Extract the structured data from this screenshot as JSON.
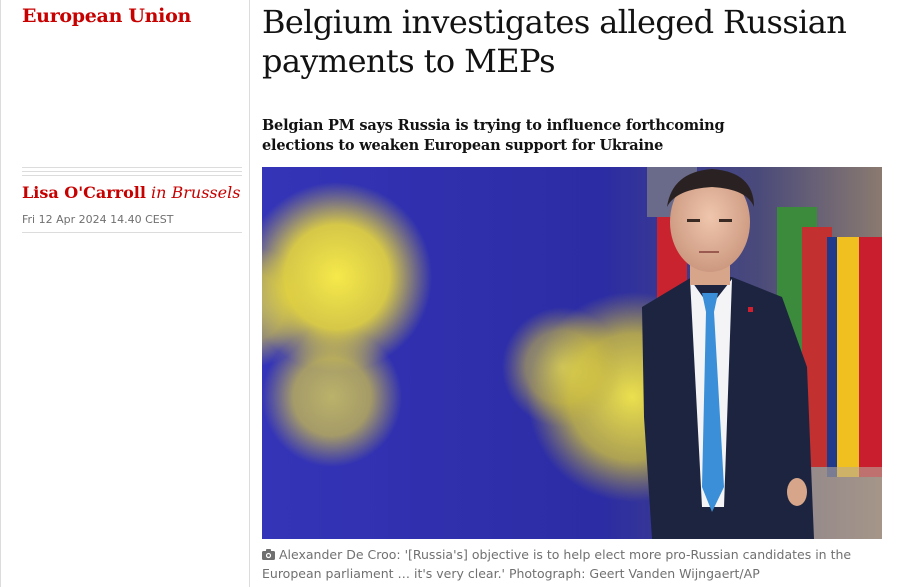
{
  "section": {
    "label": "European Union"
  },
  "byline": {
    "author": "Lisa O'Carroll",
    "location": "in Brussels"
  },
  "dateline": "Fri 12 Apr 2024 14.40 CEST",
  "article": {
    "headline": "Belgium investigates alleged Russian payments to MEPs",
    "standfirst": "Belgian PM says Russia is trying to influence forthcoming elections to weaken European support for Ukraine"
  },
  "photo": {
    "caption_icon": "camera-icon",
    "caption": "Alexander De Croo: '[Russia's] objective is to help elect more pro-Russian candidates in the European parliament … it's very clear.' Photograph: Geert Vanden Wijngaert/AP"
  },
  "colors": {
    "accent": "#c70000",
    "text": "#121212",
    "muted": "#707070",
    "rule": "#dcdcdc",
    "eu_blue": "#2b2ba8",
    "eu_yellow": "#f2e23a"
  }
}
